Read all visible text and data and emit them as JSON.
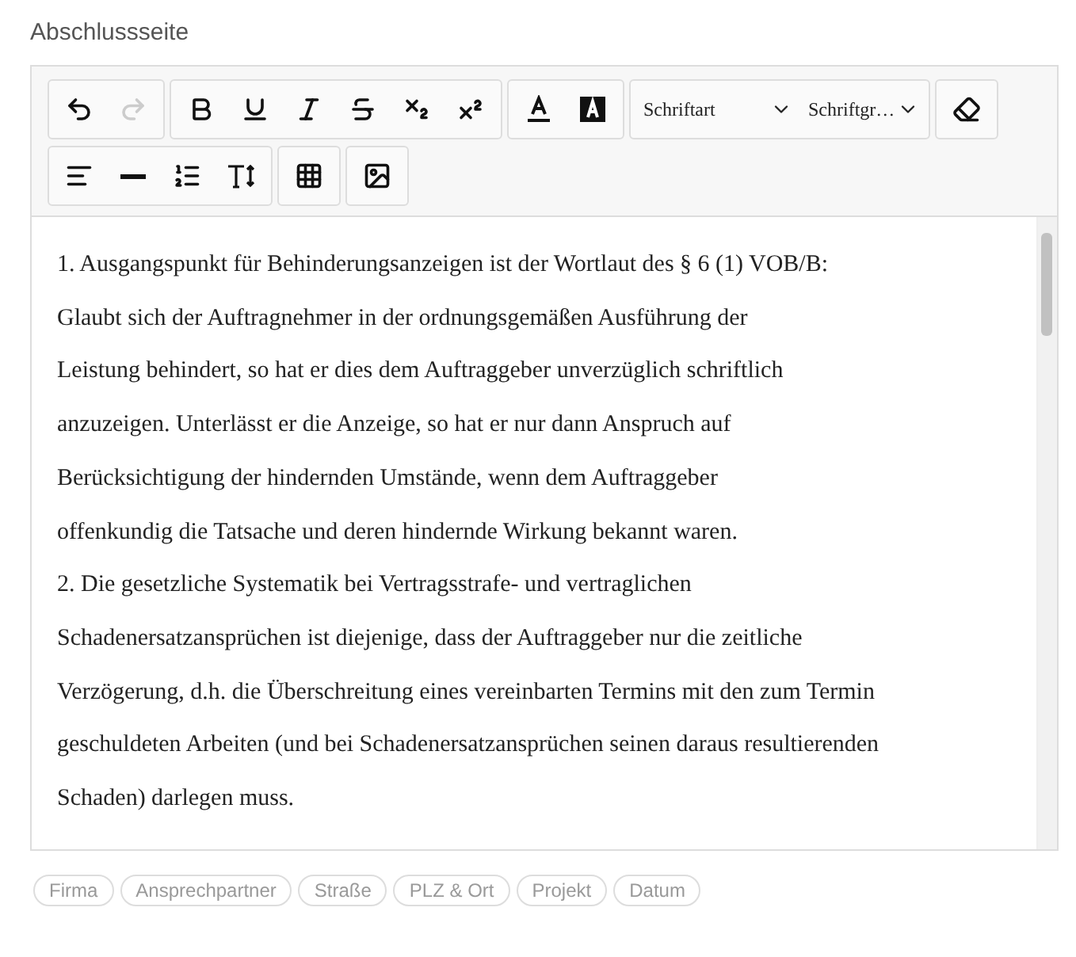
{
  "title": "Abschlussseite",
  "toolbar": {
    "rows": [
      [
        {
          "kind": "buttons",
          "buttons": [
            {
              "kind": "undo",
              "disabled": false
            },
            {
              "kind": "redo",
              "disabled": true
            }
          ]
        },
        {
          "kind": "buttons",
          "buttons": [
            {
              "kind": "bold",
              "disabled": false
            },
            {
              "kind": "underline",
              "disabled": false
            },
            {
              "kind": "italic",
              "disabled": false
            },
            {
              "kind": "strike",
              "disabled": false
            },
            {
              "kind": "subscript",
              "disabled": false
            },
            {
              "kind": "superscript",
              "disabled": false
            }
          ]
        },
        {
          "kind": "buttons",
          "buttons": [
            {
              "kind": "fontcolor",
              "disabled": false
            },
            {
              "kind": "highlight",
              "disabled": false
            }
          ]
        },
        {
          "kind": "selects",
          "selects": [
            {
              "value": "Schriftart"
            },
            {
              "value": "Schriftgr…"
            }
          ]
        },
        {
          "kind": "buttons",
          "buttons": [
            {
              "kind": "eraser",
              "disabled": false
            }
          ]
        }
      ],
      [
        {
          "kind": "buttons",
          "buttons": [
            {
              "kind": "align",
              "disabled": false
            },
            {
              "kind": "rule",
              "disabled": false
            },
            {
              "kind": "list",
              "disabled": false
            },
            {
              "kind": "lineheight",
              "disabled": false
            }
          ]
        },
        {
          "kind": "buttons",
          "buttons": [
            {
              "kind": "table",
              "disabled": false
            }
          ]
        },
        {
          "kind": "buttons",
          "buttons": [
            {
              "kind": "image",
              "disabled": false
            }
          ]
        }
      ]
    ]
  },
  "content": {
    "lines": [
      "1. Ausgangspunkt für Behinderungsanzeigen ist der Wortlaut des § 6 (1) VOB/B:",
      "Glaubt sich der Auftragnehmer in der ordnungsgemäßen Ausführung der",
      "Leistung behindert, so hat er dies dem Auftraggeber unverzüglich schriftlich",
      "anzuzeigen. Unterlässt er die Anzeige, so hat er nur dann Anspruch auf",
      "Berücksichtigung der hindernden Umstände, wenn dem Auftraggeber",
      "offenkundig die Tatsache und deren hindernde Wirkung bekannt waren.",
      "2. Die gesetzliche Systematik bei Vertragsstrafe- und vertraglichen",
      "Schadenersatzansprüchen ist diejenige, dass der Auftraggeber nur die zeitliche",
      "Verzögerung, d.h. die Überschreitung eines vereinbarten Termins mit den zum Termin",
      "geschuldeten Arbeiten (und bei Schadenersatzansprüchen seinen daraus resultierenden",
      "Schaden) darlegen muss."
    ]
  },
  "placeholders": [
    "Firma",
    "Ansprechpartner",
    "Straße",
    "PLZ & Ort",
    "Projekt",
    "Datum"
  ]
}
